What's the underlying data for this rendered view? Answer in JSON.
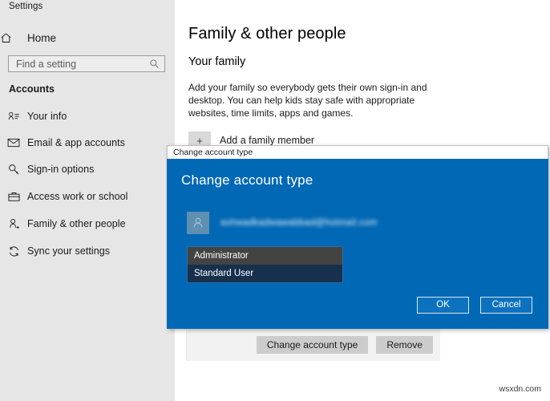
{
  "window": {
    "app_title": "Settings"
  },
  "sidebar": {
    "home_label": "Home",
    "home_icon": "home-icon",
    "search": {
      "placeholder": "Find a setting",
      "value": "",
      "icon": "search-icon"
    },
    "section_header": "Accounts",
    "items": [
      {
        "label": "Your info",
        "icon": "person-card-icon"
      },
      {
        "label": "Email & app accounts",
        "icon": "envelope-icon"
      },
      {
        "label": "Sign-in options",
        "icon": "key-icon"
      },
      {
        "label": "Access work or school",
        "icon": "briefcase-icon"
      },
      {
        "label": "Family & other people",
        "icon": "person-add-icon"
      },
      {
        "label": "Sync your settings",
        "icon": "sync-icon"
      }
    ]
  },
  "main": {
    "page_title": "Family & other people",
    "section_heading": "Your family",
    "description": "Add your family so everybody gets their own sign-in and desktop. You can help kids stay safe with appropriate websites, time limits, apps and games.",
    "add_family": {
      "plus_glyph": "+",
      "label": "Add a family member"
    },
    "partial_row_label": "",
    "account_actions": {
      "change_account_type_label": "Change account type",
      "remove_label": "Remove"
    }
  },
  "dialog": {
    "titlebar_text": "Change account type",
    "heading": "Change account type",
    "avatar_icon": "person-icon",
    "account_email": "ashwadkadwawabbad@hotmail.com",
    "account_type_options": [
      {
        "label": "Administrator",
        "selected": false
      },
      {
        "label": "Standard User",
        "selected": true
      }
    ],
    "ok_label": "OK",
    "cancel_label": "Cancel"
  },
  "watermark": {
    "text": "wsxdn.com"
  },
  "colors": {
    "dialog_blue": "#0068b5",
    "sidebar_gray": "#e6e6e6",
    "option_unselected": "#434343",
    "option_selected": "#16304d",
    "button_gray": "#cccccc"
  }
}
